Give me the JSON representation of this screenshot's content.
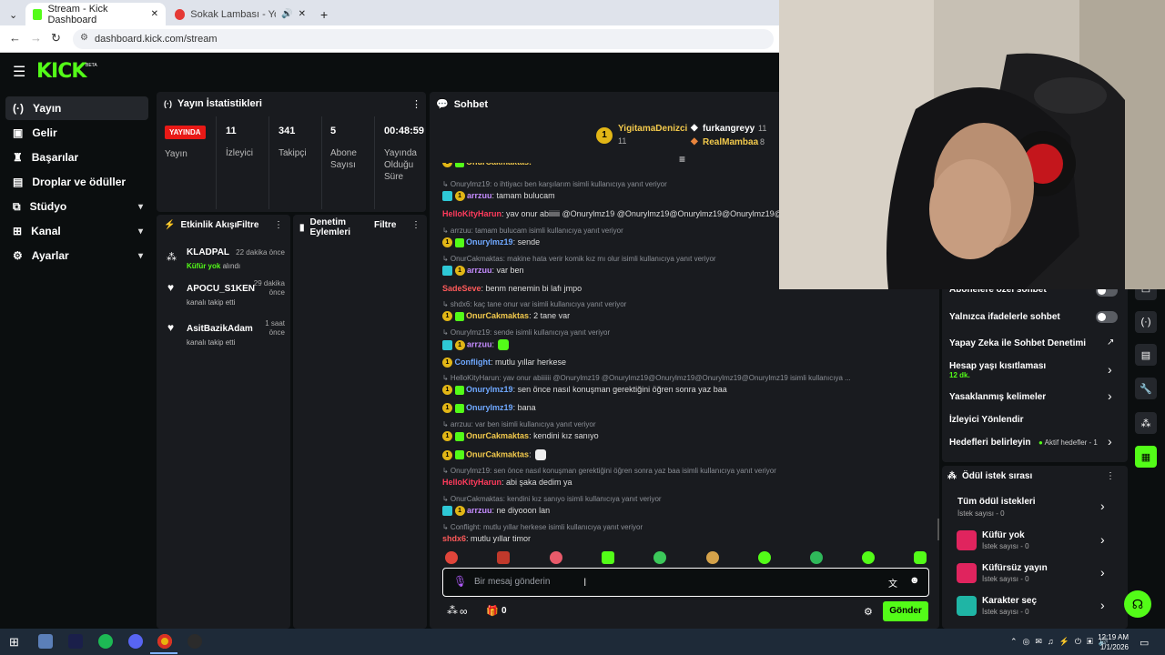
{
  "browser": {
    "tabs": [
      {
        "label": "Stream - Kick Dashboard",
        "active": true
      },
      {
        "label": "Sokak Lambası - YouTube M",
        "active": false
      }
    ],
    "url": "dashboard.kick.com/stream"
  },
  "app": {
    "logo": "KICK",
    "logo_badge": "BETA"
  },
  "sidenav": {
    "items": [
      {
        "label": "Yayın"
      },
      {
        "label": "Gelir"
      },
      {
        "label": "Başarılar"
      },
      {
        "label": "Droplar ve ödüller"
      },
      {
        "label": "Stüdyo"
      },
      {
        "label": "Kanal"
      },
      {
        "label": "Ayarlar"
      }
    ]
  },
  "stats": {
    "title": "Yayın İstatistikleri",
    "live_badge": "YAYINDA",
    "live_label": "Yayın",
    "viewers_value": "11",
    "viewers_label": "İzleyici",
    "followers_value": "341",
    "followers_label": "Takipçi",
    "subs_value": "5",
    "subs_label": "Abone Sayısı",
    "duration_value": "00:48:59",
    "duration_label": "Yayında Olduğu Süre"
  },
  "activity": {
    "title": "Etkinlik Akışı",
    "filter": "Filtre",
    "items": [
      {
        "name": "KLADPAL",
        "time": "22 dakika önce",
        "detail_highlight": "Küfür yok",
        "detail": "alındı"
      },
      {
        "name": "APOCU_S1KEN",
        "time": "29 dakika önce",
        "detail": "kanalı takip etti"
      },
      {
        "name": "AsitBazikAdam",
        "time": "1 saat önce",
        "detail": "kanalı takip etti"
      }
    ]
  },
  "moderation": {
    "title": "Denetim Eylemleri",
    "filter": "Filtre"
  },
  "chat": {
    "title": "Sohbet",
    "leaders": [
      {
        "name": "YigitamaDenizci",
        "count": "11"
      },
      {
        "name": "furkangreyy",
        "count": "11"
      },
      {
        "name": "RealMambaa",
        "count": "8"
      }
    ],
    "lines": [
      {
        "reply": "Onurylmz19: o ihtiyacı ben karşılarım isimli kullanıcıya yanıt veriyor",
        "user": "arrzuu",
        "color": "#c58cff",
        "msg": ": tamam bulucam"
      },
      {
        "user": "HelloKityHarun",
        "color": "#ff3b5c",
        "msg": ": yav onur abiiiiii @Onurylmz19 @Onurylmz19@Onurylmz19@Onurylmz19@Onurylmz19@"
      },
      {
        "reply": "arrzuu: tamam bulucam isimli kullanıcıya yanıt veriyor",
        "user": "Onurylmz19",
        "color": "#6fa8ff",
        "msg": ": sende"
      },
      {
        "reply": "OnurCakmaktas: makine hata verir komik kız mı olur isimli kullanıcıya yanıt veriyor",
        "user": "arrzuu",
        "color": "#c58cff",
        "msg": ": var ben"
      },
      {
        "user": "SadeSeve",
        "color": "#ff5a5a",
        "msg": ": benm nenemin bi lafı jmpo"
      },
      {
        "reply": "shdx6: kaç tane onur var isimli kullanıcıya yanıt veriyor",
        "user": "OnurCakmaktas",
        "color": "#f2c94c",
        "msg": ": 2 tane var"
      },
      {
        "reply": "Onurylmz19: sende isimli kullanıcıya yanıt veriyor",
        "user": "arrzuu",
        "color": "#c58cff",
        "msg": ":"
      },
      {
        "user": "Conflight",
        "color": "#6fa8ff",
        "msg": ": mutlu yıllar herkese"
      },
      {
        "reply": "HelloKityHarun: yav onur abiiiiii @Onurylmz19 @Onurylmz19@Onurylmz19@Onurylmz19@Onurylmz19 isimli kullanıcıya ...",
        "user": "Onurylmz19",
        "color": "#6fa8ff",
        "msg": ": sen önce nasıl konuşman gerektiğini öğren sonra yaz baa"
      },
      {
        "user": "Onurylmz19",
        "color": "#6fa8ff",
        "msg": ": bana"
      },
      {
        "reply": "arrzuu: var ben isimli kullanıcıya yanıt veriyor",
        "user": "OnurCakmaktas",
        "color": "#f2c94c",
        "msg": ": kendini kız sanıyo"
      },
      {
        "user": "OnurCakmaktas",
        "color": "#f2c94c",
        "msg": ":"
      },
      {
        "reply": "Onurylmz19: sen önce nasıl konuşman gerektiğini öğren sonra yaz baa isimli kullanıcıya yanıt veriyor",
        "user": "HelloKityHarun",
        "color": "#ff3b5c",
        "msg": ": abi şaka dedim ya"
      },
      {
        "reply": "OnurCakmaktas: kendini kız sanıyo isimli kullanıcıya yanıt veriyor",
        "user": "arrzuu",
        "color": "#c58cff",
        "msg": ": ne diyooon lan"
      },
      {
        "reply": "Conflight: mutlu yıllar herkese isimli kullanıcıya yanıt veriyor",
        "user": "shdx6",
        "color": "#ff5a5a",
        "msg": ": mutlu yıllar timor"
      }
    ],
    "top_partial": {
      "user": "OnurCakmaktas",
      "color": "#f2c94c",
      "msg": ":"
    },
    "input_placeholder": "Bir mesaj gönderin",
    "points": "∞",
    "gift_count": "0",
    "send": "Gönder"
  },
  "chat_settings": {
    "partial_top": "Abonelere özel sohbet",
    "emote_only": "Yalnızca ifadelerle sohbet",
    "ai_moderation": "Yapay Zeka ile Sohbet Denetimi",
    "account_age": "Hesap yaşı kısıtlaması",
    "account_age_value": "12 dk.",
    "banned_words": "Yasaklanmış kelimeler",
    "redirect": "İzleyici Yönlendir",
    "goals": "Hedefleri belirleyin",
    "goals_status": "Aktif hedefler - 1"
  },
  "rewards": {
    "title": "Ödül istek sırası",
    "items": [
      {
        "label": "Tüm ödül istekleri",
        "sub": "İstek sayısı - 0"
      },
      {
        "label": "Küfür yok",
        "sub": "İstek sayısı - 0",
        "color": "#e0245e"
      },
      {
        "label": "Küfürsüz yayın",
        "sub": "İstek sayısı - 0",
        "color": "#e0245e"
      },
      {
        "label": "Karakter seç",
        "sub": "İstek sayısı - 0",
        "color": "#1fb5a5"
      }
    ]
  },
  "taskbar": {
    "time": "12:19 AM",
    "date": "1/1/2026"
  },
  "colors": {
    "accent": "#53fc18",
    "live": "#e91916",
    "panel": "#191b1f"
  }
}
